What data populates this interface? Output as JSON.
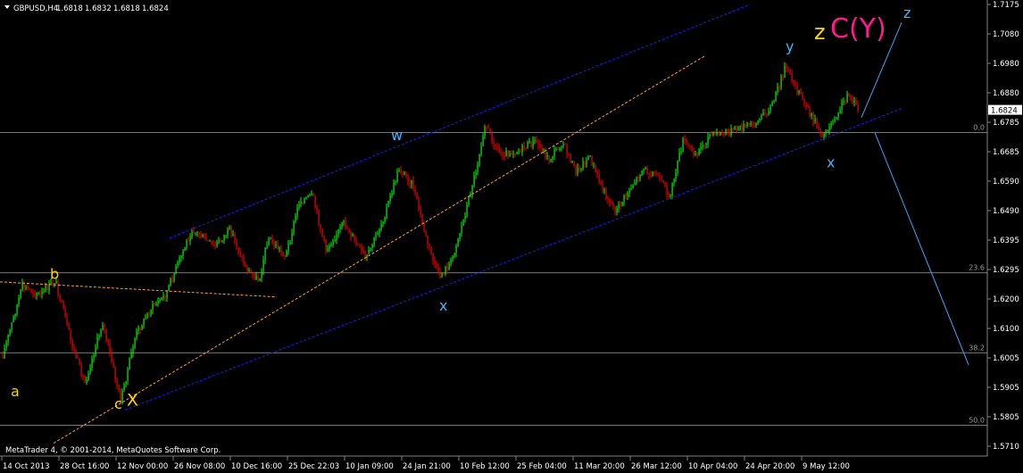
{
  "header": {
    "symbol": "GBPUSD,H4",
    "open": "1.6818",
    "high": "1.6832",
    "low": "1.6818",
    "close": "1.6824"
  },
  "footer": {
    "copyright": "MetaTrader 4, © 2001-2014, MetaQuotes Software Corp."
  },
  "current_price": "1.6824",
  "colors": {
    "background": "#000000",
    "bull_candle": "#00ff00",
    "bear_candle": "#ff0000",
    "channel": "#1a1aff",
    "fib": "#a0a0a0",
    "fan": "#ff9d2e",
    "projection": "#3aa6ff",
    "wave_yellow": "#ffd400",
    "wave_cyan": "#3cb6ff",
    "wave_magenta": "#ff1a8c"
  },
  "chart_data": {
    "type": "candlestick",
    "title": "GBPUSD,H4",
    "ylim": [
      1.571,
      1.7175
    ],
    "y_ticks": [
      "1.7175",
      "1.7080",
      "1.6980",
      "1.6880",
      "1.6785",
      "1.6685",
      "1.6590",
      "1.6490",
      "1.6395",
      "1.6295",
      "1.6200",
      "1.6100",
      "1.6005",
      "1.5905",
      "1.5805",
      "1.5710"
    ],
    "x_ticks": [
      "14 Oct 2013",
      "28 Oct 16:00",
      "12 Nov 00:00",
      "26 Nov 08:00",
      "10 Dec 16:00",
      "25 Dec 22:03",
      "10 Jan 09:00",
      "24 Jan 21:00",
      "10 Feb 12:00",
      "25 Feb 04:00",
      "11 Mar 20:00",
      "26 Mar 12:00",
      "10 Apr 04:00",
      "24 Apr 20:00",
      "9 May 12:00"
    ],
    "fib_levels": [
      {
        "label": "0.0",
        "price": 1.675
      },
      {
        "label": "23.6",
        "price": 1.6285
      },
      {
        "label": "38.2",
        "price": 1.602
      },
      {
        "label": "50.0",
        "price": 1.578
      }
    ],
    "price_path": [
      {
        "x": 0,
        "y": 1.598
      },
      {
        "x": 25,
        "y": 1.624
      },
      {
        "x": 45,
        "y": 1.621
      },
      {
        "x": 62,
        "y": 1.626
      },
      {
        "x": 80,
        "y": 1.605
      },
      {
        "x": 95,
        "y": 1.592
      },
      {
        "x": 115,
        "y": 1.612
      },
      {
        "x": 135,
        "y": 1.586
      },
      {
        "x": 152,
        "y": 1.608
      },
      {
        "x": 170,
        "y": 1.617
      },
      {
        "x": 185,
        "y": 1.621
      },
      {
        "x": 200,
        "y": 1.632
      },
      {
        "x": 215,
        "y": 1.643
      },
      {
        "x": 240,
        "y": 1.637
      },
      {
        "x": 258,
        "y": 1.643
      },
      {
        "x": 275,
        "y": 1.63
      },
      {
        "x": 290,
        "y": 1.626
      },
      {
        "x": 300,
        "y": 1.64
      },
      {
        "x": 320,
        "y": 1.634
      },
      {
        "x": 335,
        "y": 1.652
      },
      {
        "x": 350,
        "y": 1.654
      },
      {
        "x": 365,
        "y": 1.636
      },
      {
        "x": 385,
        "y": 1.645
      },
      {
        "x": 410,
        "y": 1.633
      },
      {
        "x": 430,
        "y": 1.647
      },
      {
        "x": 447,
        "y": 1.663
      },
      {
        "x": 462,
        "y": 1.658
      },
      {
        "x": 478,
        "y": 1.639
      },
      {
        "x": 492,
        "y": 1.627
      },
      {
        "x": 505,
        "y": 1.632
      },
      {
        "x": 520,
        "y": 1.647
      },
      {
        "x": 535,
        "y": 1.665
      },
      {
        "x": 543,
        "y": 1.678
      },
      {
        "x": 560,
        "y": 1.668
      },
      {
        "x": 580,
        "y": 1.669
      },
      {
        "x": 600,
        "y": 1.672
      },
      {
        "x": 615,
        "y": 1.666
      },
      {
        "x": 630,
        "y": 1.672
      },
      {
        "x": 645,
        "y": 1.662
      },
      {
        "x": 660,
        "y": 1.667
      },
      {
        "x": 675,
        "y": 1.656
      },
      {
        "x": 690,
        "y": 1.649
      },
      {
        "x": 705,
        "y": 1.656
      },
      {
        "x": 720,
        "y": 1.663
      },
      {
        "x": 735,
        "y": 1.661
      },
      {
        "x": 750,
        "y": 1.654
      },
      {
        "x": 765,
        "y": 1.672
      },
      {
        "x": 780,
        "y": 1.668
      },
      {
        "x": 795,
        "y": 1.674
      },
      {
        "x": 815,
        "y": 1.675
      },
      {
        "x": 835,
        "y": 1.677
      },
      {
        "x": 850,
        "y": 1.679
      },
      {
        "x": 865,
        "y": 1.684
      },
      {
        "x": 880,
        "y": 1.697
      },
      {
        "x": 895,
        "y": 1.688
      },
      {
        "x": 910,
        "y": 1.68
      },
      {
        "x": 922,
        "y": 1.674
      },
      {
        "x": 935,
        "y": 1.68
      },
      {
        "x": 950,
        "y": 1.688
      },
      {
        "x": 962,
        "y": 1.682
      }
    ],
    "channels": [
      {
        "name": "channel-upper",
        "color": "#1a1aff",
        "dash": true,
        "from": {
          "x": 190,
          "y": 1.64
        },
        "to": {
          "x": 840,
          "y": 1.7175
        }
      },
      {
        "name": "channel-lower",
        "color": "#1a1aff",
        "dash": true,
        "from": {
          "x": 140,
          "y": 1.583
        },
        "to": {
          "x": 1010,
          "y": 1.683
        }
      },
      {
        "name": "fan-line-1",
        "color": "#ff9d2e",
        "dash": true,
        "from": {
          "x": 60,
          "y": 1.572
        },
        "to": {
          "x": 790,
          "y": 1.7005
        }
      },
      {
        "name": "fan-line-2",
        "color": "#ff9d2e",
        "dash": true,
        "from": {
          "x": 0,
          "y": 1.6255
        },
        "to": {
          "x": 310,
          "y": 1.6205
        }
      }
    ],
    "projections": [
      {
        "name": "projection-up",
        "from": {
          "x": 965,
          "y": 1.68
        },
        "to": {
          "x": 1010,
          "y": 1.7115
        }
      },
      {
        "name": "projection-down",
        "from": {
          "x": 980,
          "y": 1.675
        },
        "to": {
          "x": 1085,
          "y": 1.598
        }
      }
    ],
    "wave_labels": [
      {
        "text": "a",
        "color": "#ffd400",
        "x": 12,
        "y": 1.5875
      },
      {
        "text": "b",
        "color": "#ffd400",
        "x": 56,
        "y": 1.6265
      },
      {
        "text": "c",
        "color": "#ffd400",
        "x": 128,
        "y": 1.5835
      },
      {
        "text": "X",
        "color": "#ffd400",
        "x": 142,
        "y": 1.5845
      },
      {
        "text": "w",
        "color": "#3cb6ff",
        "x": 438,
        "y": 1.6725
      },
      {
        "text": "x",
        "color": "#3cb6ff",
        "x": 492,
        "y": 1.616
      },
      {
        "text": "y",
        "color": "#3cb6ff",
        "x": 880,
        "y": 1.702
      },
      {
        "text": "x",
        "color": "#3cb6ff",
        "x": 926,
        "y": 1.6635
      },
      {
        "text": "z",
        "color": "#ffd400",
        "x": 912,
        "y": 1.706
      },
      {
        "text": "C(Y)",
        "color": "#ff1a8c",
        "x": 930,
        "y": 1.7065
      },
      {
        "text": "z",
        "color": "#3cb6ff",
        "x": 1012,
        "y": 1.713
      }
    ]
  }
}
